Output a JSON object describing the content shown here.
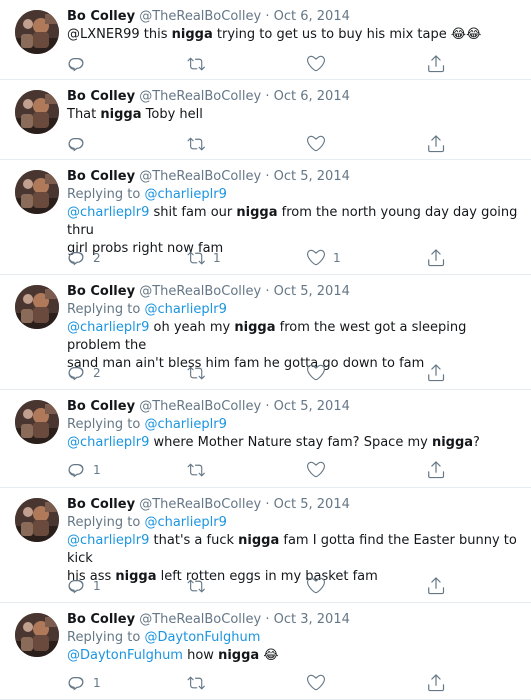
{
  "author": {
    "name": "Bo Colley",
    "handle": "@TheRealBoColley",
    "separator": "·"
  },
  "icons": {
    "reply": "reply-icon",
    "retweet": "retweet-icon",
    "like": "heart-icon",
    "share": "share-icon",
    "emoji": "tears-of-joy-emoji"
  },
  "colors": {
    "link": "#1b95e0",
    "muted": "#657786",
    "divider": "#e6ecf0",
    "text": "#14171a"
  },
  "tweets": [
    {
      "date": "Oct 6, 2014",
      "replying_to": "",
      "segments": [
        {
          "t": "text",
          "v": "@LXNER99 this "
        },
        {
          "t": "bold",
          "v": "nigga"
        },
        {
          "t": "text",
          "v": " trying to get us to buy his mix tape "
        },
        {
          "t": "emoji",
          "v": "😂"
        },
        {
          "t": "emoji",
          "v": "😂"
        }
      ],
      "replies": "",
      "retweets": "",
      "likes": ""
    },
    {
      "date": "Oct 6, 2014",
      "replying_to": "",
      "segments": [
        {
          "t": "text",
          "v": "That "
        },
        {
          "t": "bold",
          "v": "nigga"
        },
        {
          "t": "text",
          "v": " Toby hell"
        }
      ],
      "replies": "",
      "retweets": "",
      "likes": ""
    },
    {
      "date": "Oct 5, 2014",
      "replying_to": "@charlieplr9",
      "segments": [
        {
          "t": "mention",
          "v": "@charlieplr9"
        },
        {
          "t": "text",
          "v": " shit fam our "
        },
        {
          "t": "bold",
          "v": "nigga"
        },
        {
          "t": "text",
          "v": " from the north young day day going thru"
        },
        {
          "t": "br",
          "v": ""
        },
        {
          "t": "text",
          "v": "girl probs right now fam"
        }
      ],
      "replies": "2",
      "retweets": "1",
      "likes": "1"
    },
    {
      "date": "Oct 5, 2014",
      "replying_to": "@charlieplr9",
      "segments": [
        {
          "t": "mention",
          "v": "@charlieplr9"
        },
        {
          "t": "text",
          "v": " oh yeah my "
        },
        {
          "t": "bold",
          "v": "nigga"
        },
        {
          "t": "text",
          "v": " from the west got a sleeping problem the"
        },
        {
          "t": "br",
          "v": ""
        },
        {
          "t": "text",
          "v": "sand man ain't bless him fam he gotta go down to fam"
        }
      ],
      "replies": "2",
      "retweets": "",
      "likes": ""
    },
    {
      "date": "Oct 5, 2014",
      "replying_to": "@charlieplr9",
      "segments": [
        {
          "t": "mention",
          "v": "@charlieplr9"
        },
        {
          "t": "text",
          "v": " where Mother Nature stay fam? Space my "
        },
        {
          "t": "bold",
          "v": "nigga"
        },
        {
          "t": "text",
          "v": "?"
        }
      ],
      "replies": "1",
      "retweets": "",
      "likes": ""
    },
    {
      "date": "Oct 5, 2014",
      "replying_to": "@charlieplr9",
      "segments": [
        {
          "t": "mention",
          "v": "@charlieplr9"
        },
        {
          "t": "text",
          "v": " that's a fuck "
        },
        {
          "t": "bold",
          "v": "nigga"
        },
        {
          "t": "text",
          "v": " fam I gotta find the Easter bunny to kick"
        },
        {
          "t": "br",
          "v": ""
        },
        {
          "t": "text",
          "v": "his ass "
        },
        {
          "t": "bold",
          "v": "nigga"
        },
        {
          "t": "text",
          "v": " left rotten eggs in my basket fam"
        }
      ],
      "replies": "1",
      "retweets": "",
      "likes": ""
    },
    {
      "date": "Oct 3, 2014",
      "replying_to": "@DaytonFulghum",
      "segments": [
        {
          "t": "mention",
          "v": "@DaytonFulghum"
        },
        {
          "t": "text",
          "v": " how "
        },
        {
          "t": "bold",
          "v": "nigga"
        },
        {
          "t": "text",
          "v": " "
        },
        {
          "t": "emoji",
          "v": "😂"
        }
      ],
      "replies": "1",
      "retweets": "",
      "likes": ""
    }
  ],
  "labels": {
    "replying_prefix": "Replying to "
  }
}
